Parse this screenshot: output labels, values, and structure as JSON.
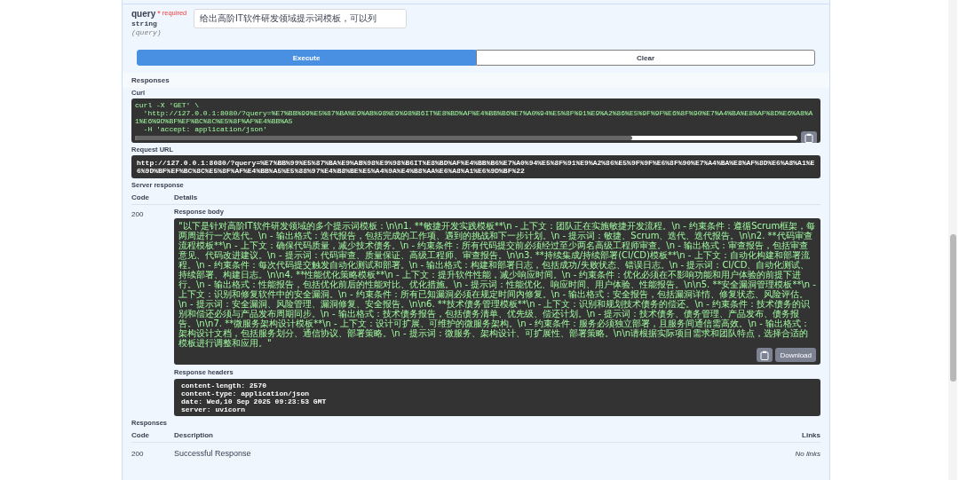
{
  "parameter": {
    "name": "query",
    "required_mark": "*",
    "required_label": "required",
    "type": "string",
    "location": "(query)",
    "value": "给出高阶IT软件研发领域提示词模板，可以列"
  },
  "actions": [
    {
      "label": "Execute",
      "kind": "primary"
    },
    {
      "label": "Clear",
      "kind": "secondary"
    }
  ],
  "responses_title": "Responses",
  "curl": {
    "label": "Curl",
    "lines": [
      "curl -X 'GET' \\",
      "  'http://127.0.0.1:8080/?query=%E7%BB%99%E5%87%BA%E9%AB%98%E9%98%B6IT%E8%BD%AF%E4%BB%B6%E7%A0%94%E5%8F%91%E9%A2%86%E5%9F%9F%E6%8F%90%E7%A4%BA%E8%AF%8D%E6%A8%A1%E6%9D%BF%EF%BC%8C%E5%8F%AF%E4%BB%A5",
      "  -H 'accept: application/json'"
    ]
  },
  "request_url": {
    "label": "Request URL",
    "value": "http://127.0.0.1:8080/?query=%E7%BB%99%E5%87%BA%E9%AB%98%E9%98%B6IT%E8%BD%AF%E4%BB%B6%E7%A0%94%E5%8F%91%E9%A2%86%E5%9F%9F%E6%8F%90%E7%A4%BA%E8%AF%8D%E6%A8%A1%E6%9D%BF%EF%BC%8C%E5%8F%AF%E4%BB%A5%E5%88%97%E4%B8%BE%E5%A4%9A%E4%B8%AA%E6%A8%A1%E6%9D%BF%22"
  },
  "server_response": {
    "label": "Server response",
    "columns": [
      "Code",
      "Details"
    ],
    "code": "200",
    "body_label": "Response body",
    "body": "\"以下是针对高阶IT软件研发领域的多个提示词模板：\\n\\n1. **敏捷开发实践模板**\\n   - 上下文：团队正在实施敏捷开发流程。\\n   - 约束条件：遵循Scrum框架，每两周进行一次迭代。\\n   - 输出格式：迭代报告，包括完成的工作项、遇到的挑战和下一步计划。\\n   - 提示词：敏捷、Scrum、迭代、迭代报告。\\n\\n2. **代码审查流程模板**\\n   - 上下文：确保代码质量，减少技术债务。\\n   - 约束条件：所有代码提交前必须经过至少两名高级工程师审查。\\n   - 输出格式：审查报告，包括审查意见、代码改进建议。\\n   - 提示词：代码审查、质量保证、高级工程师、审查报告。\\n\\n3. **持续集成/持续部署(CI/CD)模板**\\n   - 上下文：自动化构建和部署流程。\\n   - 约束条件：每次代码提交触发自动化测试和部署。\\n   - 输出格式：构建和部署日志，包括成功/失败状态、错误日志。\\n   - 提示词：CI/CD、自动化测试、持续部署、构建日志。\\n\\n4. **性能优化策略模板**\\n   - 上下文：提升软件性能，减少响应时间。\\n   - 约束条件：优化必须在不影响功能和用户体验的前提下进行。\\n   - 输出格式：性能报告，包括优化前后的性能对比、优化措施。\\n   - 提示词：性能优化、响应时间、用户体验、性能报告。\\n\\n5. **安全漏洞管理模板**\\n   - 上下文：识别和修复软件中的安全漏洞。\\n   - 约束条件：所有已知漏洞必须在规定时间内修复。\\n   - 输出格式：安全报告，包括漏洞详情、修复状态、风险评估。\\n   - 提示词：安全漏洞、风险管理、漏洞修复、安全报告。\\n\\n6. **技术债务管理模板**\\n   - 上下文：识别和规划技术债务的偿还。\\n   - 约束条件：技术债务的识别和偿还必须与产品发布周期同步。\\n   - 输出格式：技术债务报告，包括债务清单、优先级、偿还计划。\\n   - 提示词：技术债务、债务管理、产品发布、债务报告。\\n\\n7. **微服务架构设计模板**\\n   - 上下文：设计可扩展、可维护的微服务架构。\\n   - 约束条件：服务必须独立部署，且服务间通信需高效。\\n   - 输出格式：架构设计文档，包括服务划分、通信协议、部署策略。\\n   - 提示词：微服务、架构设计、可扩展性、部署策略。\\n\\n请根据实际项目需求和团队特点，选择合适的模板进行调整和应用。\"",
    "download": "Download",
    "headers_label": "Response headers",
    "headers": [
      "content-length: 2570",
      "content-type: application/json",
      "date: Wed,10 Sep 2025 09:23:53 GMT",
      "server: uvicorn"
    ]
  },
  "responses": {
    "title": "Responses",
    "columns": [
      "Code",
      "Description",
      "Links"
    ],
    "rows": [
      {
        "code": "200",
        "description": "Successful Response",
        "links": "No links"
      }
    ]
  }
}
